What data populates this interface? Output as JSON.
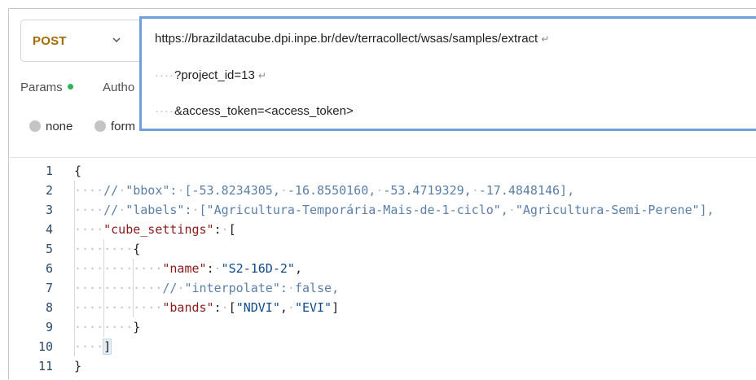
{
  "method": {
    "value": "POST",
    "chevron_icon": "chevron-down-icon"
  },
  "tabs": [
    {
      "label": "Params",
      "indicator_color": "#2fb35a"
    },
    {
      "label": "Autho"
    }
  ],
  "body_types": [
    {
      "label": "none"
    },
    {
      "label": "form"
    }
  ],
  "url": {
    "lines": [
      {
        "indent": "",
        "text": "https://brazildatacube.dpi.inpe.br/dev/terracollect/wsas/samples/extract",
        "wrap_marker": "↵"
      },
      {
        "indent": "····",
        "text": "?project_id=13",
        "wrap_marker": "↵"
      },
      {
        "indent": "····",
        "text": "&access_token=<access_token>",
        "wrap_marker": ""
      }
    ]
  },
  "editor": {
    "line_numbers": [
      "1",
      "2",
      "3",
      "4",
      "5",
      "6",
      "7",
      "8",
      "9",
      "10",
      "11"
    ],
    "lines": [
      [
        {
          "t": "pun",
          "v": "{"
        }
      ],
      [
        {
          "t": "ws",
          "v": "····"
        },
        {
          "t": "cmt",
          "v": "//"
        },
        {
          "t": "ws",
          "v": "·"
        },
        {
          "t": "cmt",
          "v": "\"bbox\":"
        },
        {
          "t": "ws",
          "v": "·"
        },
        {
          "t": "cmt",
          "v": "[-53.8234305,"
        },
        {
          "t": "ws",
          "v": "·"
        },
        {
          "t": "cmt",
          "v": "-16.8550160,"
        },
        {
          "t": "ws",
          "v": "·"
        },
        {
          "t": "cmt",
          "v": "-53.4719329,"
        },
        {
          "t": "ws",
          "v": "·"
        },
        {
          "t": "cmt",
          "v": "-17.4848146],"
        }
      ],
      [
        {
          "t": "ws",
          "v": "····"
        },
        {
          "t": "cmt",
          "v": "//"
        },
        {
          "t": "ws",
          "v": "·"
        },
        {
          "t": "cmt",
          "v": "\"labels\":"
        },
        {
          "t": "ws",
          "v": "·"
        },
        {
          "t": "cmt",
          "v": "[\"Agricultura-Temporária-Mais-de-1-ciclo\","
        },
        {
          "t": "ws",
          "v": "·"
        },
        {
          "t": "cmt",
          "v": "\"Agricultura-Semi-Perene\"],"
        }
      ],
      [
        {
          "t": "ws",
          "v": "····"
        },
        {
          "t": "key",
          "v": "\"cube_settings\""
        },
        {
          "t": "pun",
          "v": ":"
        },
        {
          "t": "ws",
          "v": "·"
        },
        {
          "t": "pun",
          "v": "["
        }
      ],
      [
        {
          "t": "ws",
          "v": "········"
        },
        {
          "t": "pun",
          "v": "{"
        }
      ],
      [
        {
          "t": "ws",
          "v": "············"
        },
        {
          "t": "key",
          "v": "\"name\""
        },
        {
          "t": "pun",
          "v": ":"
        },
        {
          "t": "ws",
          "v": "·"
        },
        {
          "t": "str",
          "v": "\"S2-16D-2\""
        },
        {
          "t": "pun",
          "v": ","
        }
      ],
      [
        {
          "t": "ws",
          "v": "············"
        },
        {
          "t": "cmt",
          "v": "//"
        },
        {
          "t": "ws",
          "v": "·"
        },
        {
          "t": "cmt",
          "v": "\"interpolate\":"
        },
        {
          "t": "ws",
          "v": "·"
        },
        {
          "t": "cmt",
          "v": "false,"
        }
      ],
      [
        {
          "t": "ws",
          "v": "············"
        },
        {
          "t": "key",
          "v": "\"bands\""
        },
        {
          "t": "pun",
          "v": ":"
        },
        {
          "t": "ws",
          "v": "·"
        },
        {
          "t": "pun",
          "v": "["
        },
        {
          "t": "str",
          "v": "\"NDVI\""
        },
        {
          "t": "pun",
          "v": ","
        },
        {
          "t": "ws",
          "v": "·"
        },
        {
          "t": "str",
          "v": "\"EVI\""
        },
        {
          "t": "pun",
          "v": "]"
        }
      ],
      [
        {
          "t": "ws",
          "v": "········"
        },
        {
          "t": "pun",
          "v": "}"
        }
      ],
      [
        {
          "t": "ws",
          "v": "····"
        },
        {
          "t": "pun",
          "v": "]"
        }
      ],
      [
        {
          "t": "pun",
          "v": "}"
        }
      ]
    ]
  }
}
